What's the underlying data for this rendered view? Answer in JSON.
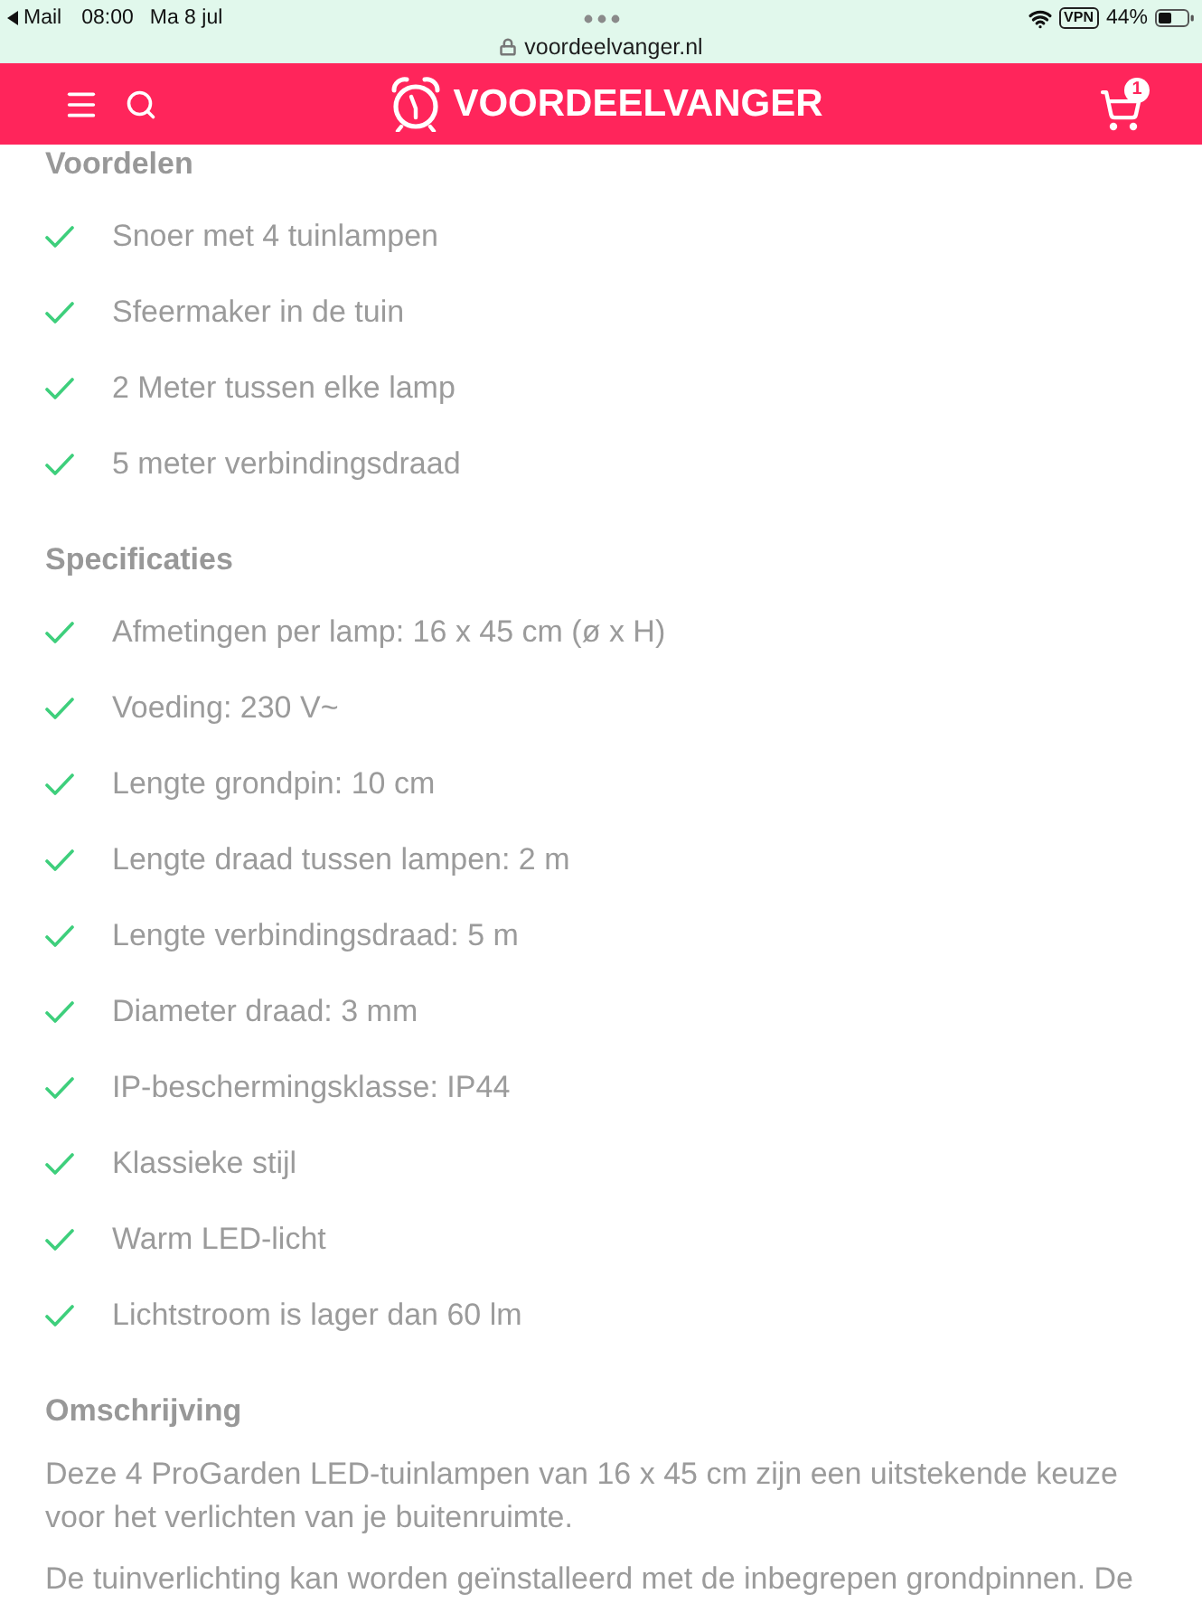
{
  "status_bar": {
    "back_app": "Mail",
    "time": "08:00",
    "date": "Ma 8 jul",
    "vpn": "VPN",
    "battery": "44%"
  },
  "address_bar": {
    "url": "voordeelvanger.nl"
  },
  "header": {
    "logo": "VOORDEELVANGER",
    "cart_count": "1"
  },
  "sections": [
    {
      "kind": "checklist",
      "title": "Voordelen",
      "items": [
        "Snoer met 4 tuinlampen",
        "Sfeermaker in de tuin",
        "2 Meter tussen elke lamp",
        "5 meter verbindingsdraad"
      ]
    },
    {
      "kind": "checklist",
      "title": "Specificaties",
      "items": [
        "Afmetingen per lamp: 16 x 45 cm (ø x H)",
        "Voeding: 230 V~",
        "Lengte grondpin: 10 cm",
        "Lengte draad tussen lampen: 2 m",
        "Lengte verbindingsdraad: 5 m",
        "Diameter draad: 3 mm",
        "IP-beschermingsklasse: IP44",
        "Klassieke stijl",
        "Warm LED-licht",
        "Lichtstroom is lager dan 60 lm"
      ]
    },
    {
      "kind": "text",
      "title": "Omschrijving",
      "paragraphs": [
        "Deze 4 ProGarden LED-tuinlampen van 16 x 45 cm zijn een uitstekende keuze voor het verlichten van je buitenruimte.",
        "De tuinverlichting kan worden geïnstalleerd met de inbegrepen grondpinnen. De"
      ]
    }
  ]
}
